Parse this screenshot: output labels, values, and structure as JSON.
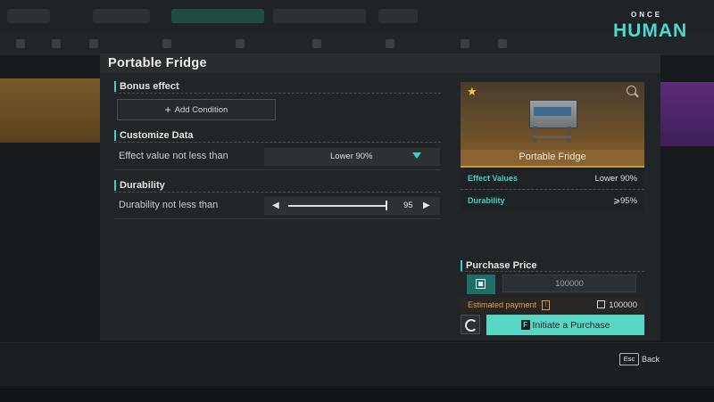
{
  "logo": {
    "line1": "ONCE",
    "line2": "HUMAN"
  },
  "modal": {
    "title": "Portable Fridge"
  },
  "bonus": {
    "heading": "Bonus effect",
    "add_label": "Add Condition"
  },
  "customize": {
    "heading": "Customize Data",
    "effect_label": "Effect value not less than",
    "effect_value": "Lower 90%"
  },
  "durability": {
    "heading": "Durability",
    "label": "Durability not less than",
    "value": "95",
    "level_percent": 95
  },
  "item": {
    "name": "Portable Fridge",
    "stats": [
      {
        "key": "Effect Values",
        "value": "Lower 90%"
      },
      {
        "key": "Durability",
        "value": "⩾95%"
      }
    ]
  },
  "purchase": {
    "heading": "Purchase Price",
    "price": "100000",
    "estimated_label": "Estimated payment",
    "estimated_value": "100000",
    "buy_key": "F",
    "buy_label": "Initiate a Purchase"
  },
  "footer": {
    "esc_key": "Esc",
    "esc_label": "Back"
  },
  "colors": {
    "accent": "#3fd2c4",
    "button": "#58d6c4",
    "gold": "#d8a542"
  }
}
